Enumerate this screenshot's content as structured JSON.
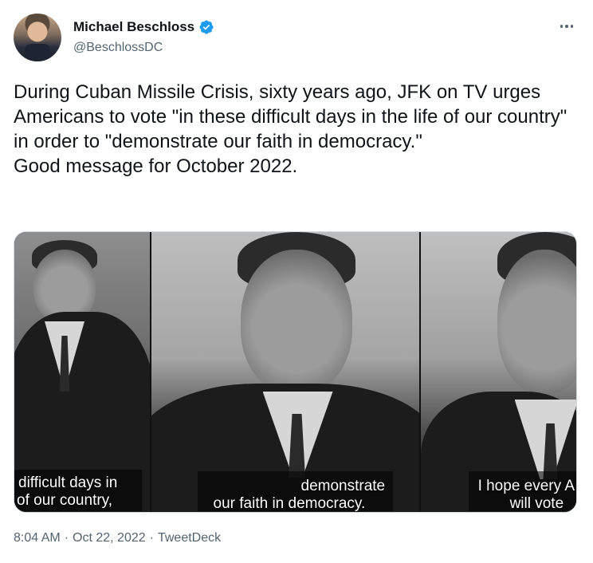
{
  "author": {
    "display_name": "Michael Beschloss",
    "handle": "@BeschlossDC",
    "verified": true,
    "verified_color": "#1d9bf0"
  },
  "tweet": {
    "text": "During Cuban Missile Crisis, sixty years ago, JFK on TV urges Americans to vote \"in these difficult days in the life of our country\" in order to \"demonstrate our faith in democracy.\"\nGood message for October 2022."
  },
  "media": {
    "frames": [
      {
        "caption_line1": "difficult days in",
        "caption_line2": "of our country,"
      },
      {
        "caption_line1": "demonstrate",
        "caption_line2": "our faith in democracy."
      },
      {
        "caption_line1": "I hope every A",
        "caption_line2": "will vote"
      }
    ]
  },
  "meta": {
    "time": "8:04 AM",
    "separator": "·",
    "date": "Oct 22, 2022",
    "source": "TweetDeck"
  },
  "colors": {
    "text": "#0f1419",
    "secondary": "#536471",
    "border": "#cfd9de"
  },
  "icons": {
    "verified": "verified-badge-icon",
    "more": "more-options-icon"
  }
}
